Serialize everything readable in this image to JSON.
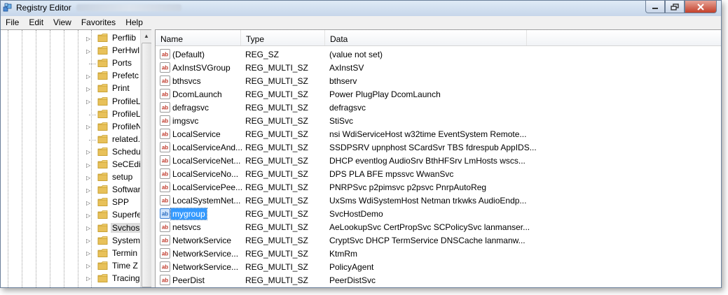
{
  "window": {
    "title": "Registry Editor"
  },
  "menu": [
    "File",
    "Edit",
    "View",
    "Favorites",
    "Help"
  ],
  "tree": {
    "items": [
      {
        "label": "Perflib",
        "expandable": true
      },
      {
        "label": "PerHwI",
        "expandable": true
      },
      {
        "label": "Ports",
        "expandable": false
      },
      {
        "label": "Prefetc",
        "expandable": true
      },
      {
        "label": "Print",
        "expandable": true
      },
      {
        "label": "ProfileL",
        "expandable": true
      },
      {
        "label": "ProfileL",
        "expandable": false
      },
      {
        "label": "ProfileN",
        "expandable": true
      },
      {
        "label": "related.",
        "expandable": false
      },
      {
        "label": "Schedu",
        "expandable": true
      },
      {
        "label": "SeCEdit",
        "expandable": true
      },
      {
        "label": "setup",
        "expandable": true
      },
      {
        "label": "Softwar",
        "expandable": true
      },
      {
        "label": "SPP",
        "expandable": true
      },
      {
        "label": "Superfe",
        "expandable": true
      },
      {
        "label": "Svchos",
        "expandable": true,
        "selected": true
      },
      {
        "label": "System",
        "expandable": true
      },
      {
        "label": "Termin",
        "expandable": true
      },
      {
        "label": "Time Z",
        "expandable": true
      },
      {
        "label": "Tracing",
        "expandable": true
      }
    ]
  },
  "list": {
    "columns": [
      "Name",
      "Type",
      "Data"
    ],
    "rows": [
      {
        "name": "(Default)",
        "type": "REG_SZ",
        "data": "(value not set)"
      },
      {
        "name": "AxInstSVGroup",
        "type": "REG_MULTI_SZ",
        "data": "AxInstSV"
      },
      {
        "name": "bthsvcs",
        "type": "REG_MULTI_SZ",
        "data": "bthserv"
      },
      {
        "name": "DcomLaunch",
        "type": "REG_MULTI_SZ",
        "data": "Power PlugPlay DcomLaunch"
      },
      {
        "name": "defragsvc",
        "type": "REG_MULTI_SZ",
        "data": "defragsvc"
      },
      {
        "name": "imgsvc",
        "type": "REG_MULTI_SZ",
        "data": "StiSvc"
      },
      {
        "name": "LocalService",
        "type": "REG_MULTI_SZ",
        "data": "nsi WdiServiceHost w32time EventSystem Remote..."
      },
      {
        "name": "LocalServiceAnd...",
        "type": "REG_MULTI_SZ",
        "data": "SSDPSRV upnphost SCardSvr TBS fdrespub AppIDS..."
      },
      {
        "name": "LocalServiceNet...",
        "type": "REG_MULTI_SZ",
        "data": "DHCP eventlog AudioSrv BthHFSrv LmHosts wscs..."
      },
      {
        "name": "LocalServiceNo...",
        "type": "REG_MULTI_SZ",
        "data": "DPS PLA BFE mpssvc WwanSvc"
      },
      {
        "name": "LocalServicePee...",
        "type": "REG_MULTI_SZ",
        "data": "PNRPSvc p2pimsvc p2psvc PnrpAutoReg"
      },
      {
        "name": "LocalSystemNet...",
        "type": "REG_MULTI_SZ",
        "data": "UxSms WdiSystemHost Netman trkwks AudioEndp..."
      },
      {
        "name": "mygroup",
        "type": "REG_MULTI_SZ",
        "data": "SvcHostDemo",
        "selected": true
      },
      {
        "name": "netsvcs",
        "type": "REG_MULTI_SZ",
        "data": "AeLookupSvc CertPropSvc SCPolicySvc lanmanser..."
      },
      {
        "name": "NetworkService",
        "type": "REG_MULTI_SZ",
        "data": "CryptSvc DHCP TermService DNSCache lanmanw..."
      },
      {
        "name": "NetworkService...",
        "type": "REG_MULTI_SZ",
        "data": "KtmRm"
      },
      {
        "name": "NetworkService...",
        "type": "REG_MULTI_SZ",
        "data": "PolicyAgent"
      },
      {
        "name": "PeerDist",
        "type": "REG_MULTI_SZ",
        "data": "PeerDistSvc"
      }
    ]
  },
  "icons": {
    "app": "registry-editor-icon",
    "folder": "folder-icon",
    "value": "string-value-icon"
  },
  "colors": {
    "selection": "#3399ff",
    "folder": "#e8c15a",
    "value_icon_text": "#c0392b"
  }
}
